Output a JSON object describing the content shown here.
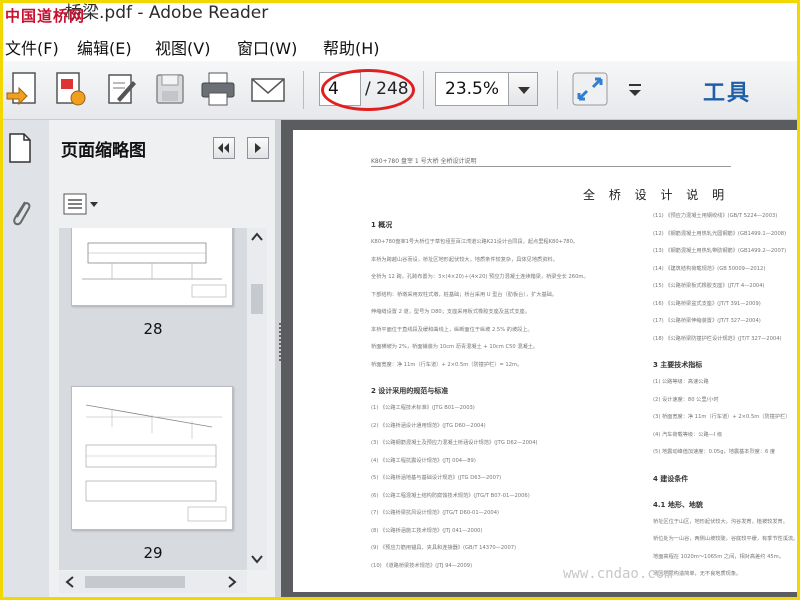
{
  "window": {
    "title": "桥梁.pdf - Adobe Reader",
    "watermark_top": "中国道桥网"
  },
  "menu": [
    "文件(F)",
    "编辑(E)",
    "视图(V)",
    "窗口(W)",
    "帮助(H)"
  ],
  "toolbar": {
    "current_page": "4",
    "total_pages": "/ 248",
    "zoom": "23.5%",
    "tools_label": "工具"
  },
  "thumbnails_panel": {
    "title": "页面缩略图",
    "pages": [
      "28",
      "29"
    ]
  },
  "document": {
    "header": "K80+780 盘宰 1 号大桥 全桥设计说明",
    "title": "全 桥 设 计 说 明",
    "left_column": [
      {
        "type": "head",
        "text": "1   概况"
      },
      {
        "type": "line",
        "text": "K80+780盘宰1号大桥位于草包垭至百江湾道公路K21设计合同段，起点里程K80+780。"
      },
      {
        "type": "line",
        "text": "本桥为跨越山谷而设，桥址区地形起伏较大，地质条件较复杂，具体见地质资料。"
      },
      {
        "type": "line",
        "text": "全桥为 12 跨，孔跨布置为：3×(4×20)＋(4×20) 预应力混凝土连续箱梁，桥梁全长 260m。"
      },
      {
        "type": "line",
        "text": "下部结构：桥墩采用双柱式墩，桩基础；桥台采用 U 型台（肋板台），扩大基础。"
      },
      {
        "type": "line",
        "text": "伸缩缝设置 2 道，型号为 D80；支座采用板式橡胶支座及盆式支座。"
      },
      {
        "type": "line",
        "text": "本桥平面位于直线段及缓和曲线上，纵断面位于纵坡 2.5% 的坡段上。"
      },
      {
        "type": "line",
        "text": "桥面横坡为 2%，桥面铺装为 10cm 沥青混凝土 + 10cm C50 混凝土。"
      },
      {
        "type": "line",
        "text": "桥面宽度：净 11m（行车道）+ 2×0.5m（防撞护栏）= 12m。"
      },
      {
        "type": "head",
        "text": "2   设计采用的规范与标准"
      },
      {
        "type": "line",
        "text": "(1)  《公路工程技术标准》(JTG B01—2003)"
      },
      {
        "type": "line",
        "text": "(2)  《公路桥涵设计通用规范》(JTG D60—2004)"
      },
      {
        "type": "line",
        "text": "(3)  《公路钢筋混凝土及预应力混凝土桥涵设计规范》(JTG D62—2004)"
      },
      {
        "type": "line",
        "text": "(4)  《公路工程抗震设计规范》(JTJ 004—89)"
      },
      {
        "type": "line",
        "text": "(5)  《公路桥涵地基与基础设计规范》(JTG D63—2007)"
      },
      {
        "type": "line",
        "text": "(6)  《公路工程混凝土结构防腐蚀技术规范》(JTG/T B07-01—2006)"
      },
      {
        "type": "line",
        "text": "(7)  《公路桥梁抗风设计规范》(JTG/T D60-01—2004)"
      },
      {
        "type": "line",
        "text": "(8)  《公路桥涵施工技术规范》(JTJ 041—2000)"
      },
      {
        "type": "line",
        "text": "(9)  《预应力筋用锚具、夹具和连接器》(GB/T 14370—2007)"
      },
      {
        "type": "line",
        "text": "(10) 《道路桥梁技术规范》(JTJ 94—2009)"
      }
    ],
    "right_column": [
      {
        "type": "line",
        "text": "(11) 《预应力混凝土用钢绞线》(GB/T 5224—2003)"
      },
      {
        "type": "line",
        "text": "(12) 《钢筋混凝土用热轧光圆钢筋》(GB1499.1—2008)"
      },
      {
        "type": "line",
        "text": "(13) 《钢筋混凝土用热轧带肋钢筋》(GB1499.2—2007)"
      },
      {
        "type": "line",
        "text": "(14) 《建筑结构荷载规范》(GB 50009—2012)"
      },
      {
        "type": "line",
        "text": "(15) 《公路桥梁板式橡胶支座》(JT/T 4—2004)"
      },
      {
        "type": "line",
        "text": "(16) 《公路桥梁盆式支座》(JT/T 391—2009)"
      },
      {
        "type": "line",
        "text": "(17) 《公路桥梁伸缩装置》(JT/T 327—2004)"
      },
      {
        "type": "line",
        "text": "(18) 《公路桥梁防撞护栏设计规范》(JT/T 327—2004)"
      },
      {
        "type": "head",
        "text": "3   主要技术指标"
      },
      {
        "type": "line",
        "text": "(1)  公路等级：高速公路"
      },
      {
        "type": "line",
        "text": "(2)  设计速度：80 公里/小时"
      },
      {
        "type": "line",
        "text": "(3)  桥面宽度：净 11m（行车道）+ 2×0.5m（防撞护栏）"
      },
      {
        "type": "line",
        "text": "(4)  汽车荷载等级：公路—I 级"
      },
      {
        "type": "line",
        "text": "(5)  地震动峰值加速度：0.05g，地震基本烈度：6 度"
      },
      {
        "type": "head",
        "text": "4   建设条件"
      },
      {
        "type": "head",
        "text": "4.1  地形、地貌"
      },
      {
        "type": "line",
        "text": "桥址区位于山区，地形起伏较大，沟谷发育，植被较发育。"
      },
      {
        "type": "line",
        "text": "桥位处为一山谷，两侧山坡较陡，谷底较平缓，有季节性溪流。"
      },
      {
        "type": "line",
        "text": "地面高程在 1020m～1065m 之间，相对高差约 45m。"
      },
      {
        "type": "line",
        "text": "场区地质构造简单，无不良地质现象。"
      }
    ]
  },
  "watermark_bottom": "www.cndao.com"
}
